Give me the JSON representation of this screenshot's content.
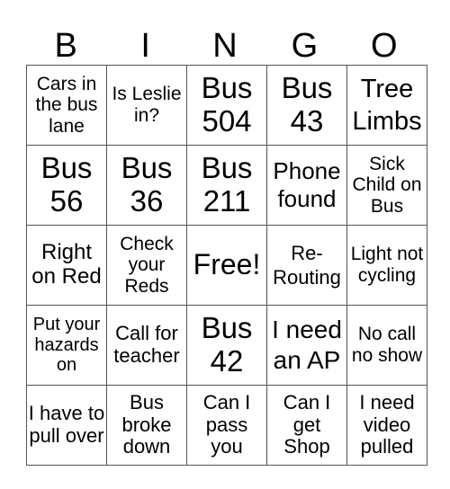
{
  "header": [
    "B",
    "I",
    "N",
    "G",
    "O"
  ],
  "rows": [
    [
      "Cars in the bus lane",
      "Is Leslie in?",
      "Bus 504",
      "Bus 43",
      "Tree Limbs"
    ],
    [
      "Bus 56",
      "Bus 36",
      "Bus 211",
      "Phone found",
      "Sick Child on Bus"
    ],
    [
      "Right on Red",
      "Check your Reds",
      "Free!",
      "Re-Routing",
      "Light not cycling"
    ],
    [
      "Put your hazards on",
      "Call for teacher",
      "Bus 42",
      "I need an AP",
      "No call no show"
    ],
    [
      "I have to pull over",
      "Bus broke down",
      "Can I pass you",
      "Can I get Shop",
      "I need video pulled"
    ]
  ]
}
